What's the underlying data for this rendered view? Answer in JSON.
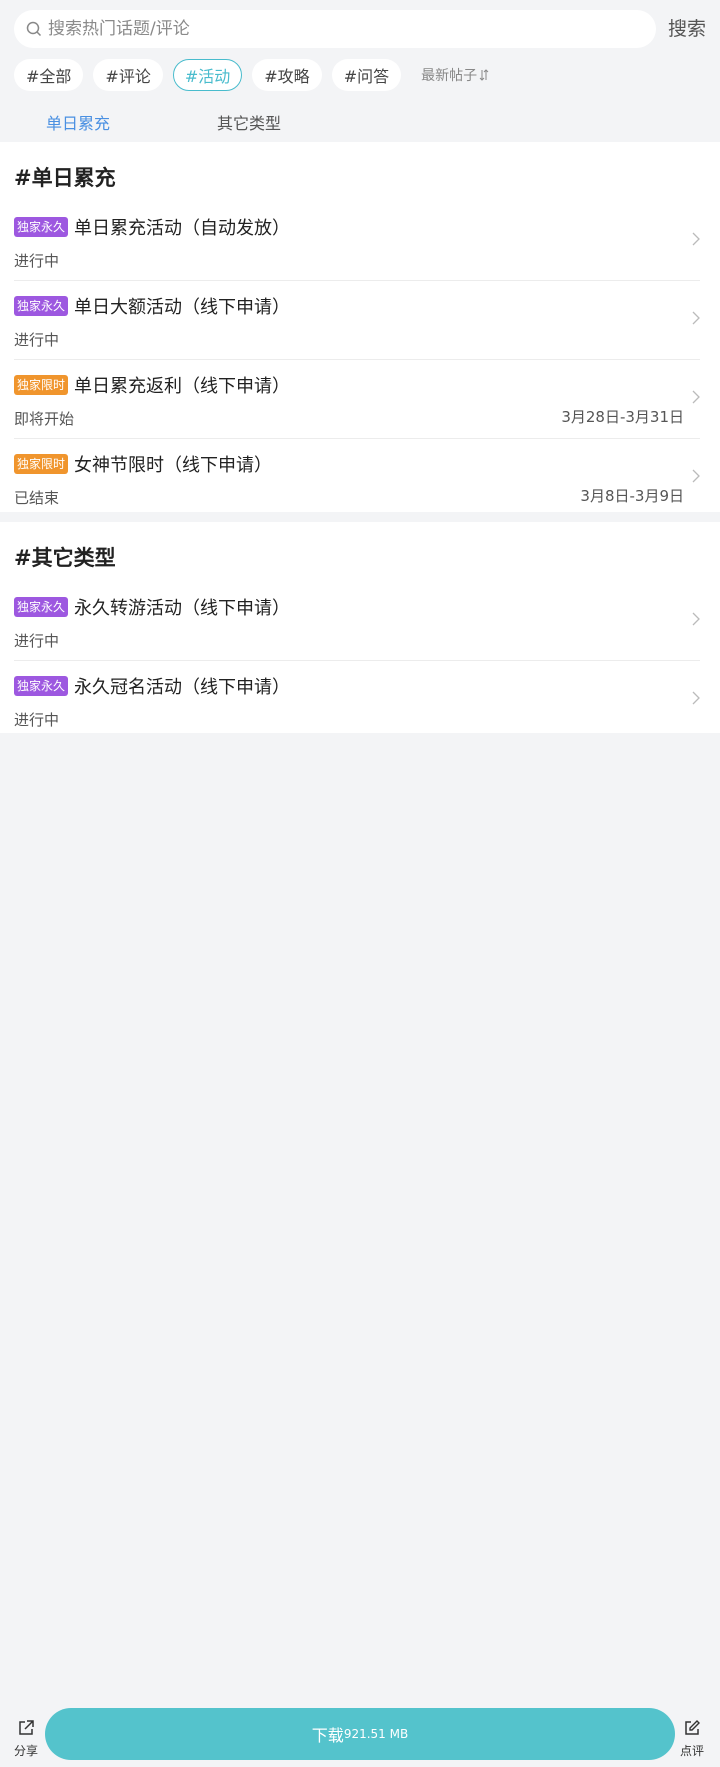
{
  "search": {
    "placeholder": "搜索热门话题/评论",
    "button": "搜索"
  },
  "chips": [
    "#全部",
    "#评论",
    "#活动",
    "#攻略",
    "#问答"
  ],
  "active_chip": "#活动",
  "sort_label": "最新帖子",
  "tabs": [
    "单日累充",
    "其它类型"
  ],
  "active_tab": "单日累充",
  "sections": [
    {
      "title": "#单日累充",
      "items": [
        {
          "badge": "独家永久",
          "title": "单日累充活动（自动发放）",
          "status": "进行中",
          "date": ""
        },
        {
          "badge": "独家永久",
          "title": "单日大额活动（线下申请）",
          "status": "进行中",
          "date": ""
        },
        {
          "badge": "独家限时",
          "title": "单日累充返利（线下申请）",
          "status": "即将开始",
          "date": "3月28日-3月31日"
        },
        {
          "badge": "独家限时",
          "title": "女神节限时（线下申请）",
          "status": "已结束",
          "date": "3月8日-3月9日"
        }
      ]
    },
    {
      "title": "#其它类型",
      "items": [
        {
          "badge": "独家永久",
          "title": "永久转游活动（线下申请）",
          "status": "进行中",
          "date": ""
        },
        {
          "badge": "独家永久",
          "title": "永久冠名活动（线下申请）",
          "status": "进行中",
          "date": ""
        }
      ]
    }
  ],
  "bottom": {
    "share": "分享",
    "download": "下载",
    "size": "921.51 MB",
    "review": "点评"
  },
  "colors": {
    "accent": "#49bccd",
    "tab_active": "#4a90e2",
    "badge_permanent": "#9d58e0",
    "badge_limited": "#f0952d",
    "download": "#54c3cc"
  }
}
